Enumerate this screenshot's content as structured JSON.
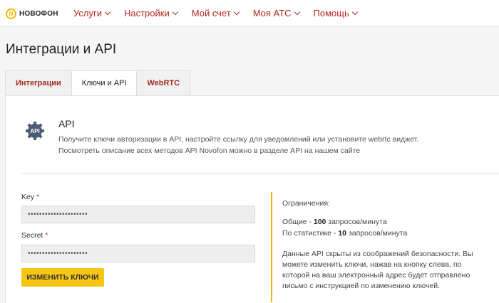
{
  "logo": {
    "badge": "N",
    "text": "НОВОФОН"
  },
  "nav": [
    {
      "label": "Услуги"
    },
    {
      "label": "Настройки"
    },
    {
      "label": "Мой счет"
    },
    {
      "label": "Моя АТС"
    },
    {
      "label": "Помощь"
    }
  ],
  "page_title": "Интеграции и API",
  "tabs": [
    {
      "label": "Интеграции",
      "active": false
    },
    {
      "label": "Ключи и API",
      "active": true
    },
    {
      "label": "WebRTC",
      "active": false
    }
  ],
  "api": {
    "icon_label": "API",
    "heading": "API",
    "desc_line1": "Получите ключи авторизации в API, настройте ссылку для уведомлений или установите webrtc виджет.",
    "desc_line2": "Посмотреть описание всех методов API Novofon можно в разделе API на нашем сайте"
  },
  "form": {
    "key_label": "Key",
    "key_value": "•••••••••••••••••••••",
    "secret_label": "Secret",
    "secret_value": "•••••••••••••••••••••",
    "required_mark": "*",
    "change_button": "ИЗМЕНИТЬ КЛЮЧИ"
  },
  "limits": {
    "title": "Ограничения:",
    "general_prefix": "Общие - ",
    "general_value": "100",
    "general_suffix": " запросов/минута",
    "stats_prefix": "По статистике - ",
    "stats_value": "10",
    "stats_suffix": " запросов/минута",
    "note1": "Данные API скрыты из соображений безопасности. Вы",
    "note2": "можете изменить ключи, нажав на кнопку слева, по",
    "note3": "которой на ваш электронный адрес будет отправлено",
    "note4": "письмо с инструкцией по изменению ключей."
  },
  "colors": {
    "accent": "#f7c513",
    "nav_text": "#b3261e",
    "required": "#c0392b"
  }
}
